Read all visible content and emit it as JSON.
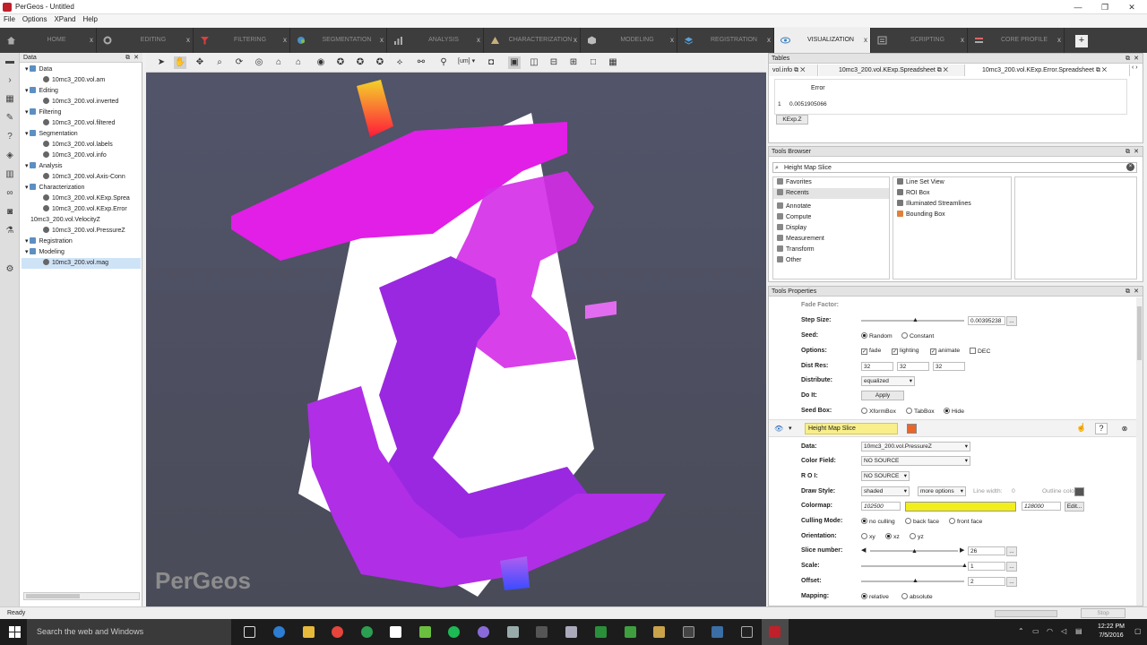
{
  "window": {
    "title": "PerGeos - Untitled"
  },
  "menu": [
    "File",
    "Options",
    "XPand",
    "Help"
  ],
  "tabs": [
    {
      "label": "HOME",
      "icon": "home-icon"
    },
    {
      "label": "EDITING",
      "icon": "gears-icon"
    },
    {
      "label": "FILTERING",
      "icon": "filter-icon"
    },
    {
      "label": "SEGMENTATION",
      "icon": "segmentation-icon"
    },
    {
      "label": "ANALYSIS",
      "icon": "chart-icon"
    },
    {
      "label": "CHARACTERIZATION",
      "icon": "characterization-icon"
    },
    {
      "label": "MODELING",
      "icon": "cube-icon"
    },
    {
      "label": "REGISTRATION",
      "icon": "layers-icon"
    },
    {
      "label": "VISUALIZATION",
      "icon": "eye-icon",
      "active": true
    },
    {
      "label": "SCRIPTING",
      "icon": "script-icon"
    },
    {
      "label": "CORE PROFILE",
      "icon": "core-profile-icon"
    }
  ],
  "data_panel": {
    "title": "Data",
    "tree": [
      {
        "label": "Data",
        "level": 0,
        "kind": "folder"
      },
      {
        "label": "10mc3_200.vol.am",
        "level": 1,
        "kind": "item"
      },
      {
        "label": "Editing",
        "level": 0,
        "kind": "folder"
      },
      {
        "label": "10mc3_200.vol.inverted",
        "level": 1,
        "kind": "item"
      },
      {
        "label": "Filtering",
        "level": 0,
        "kind": "folder"
      },
      {
        "label": "10mc3_200.vol.filtered",
        "level": 1,
        "kind": "item"
      },
      {
        "label": "Segmentation",
        "level": 0,
        "kind": "folder"
      },
      {
        "label": "10mc3_200.vol.labels",
        "level": 1,
        "kind": "item"
      },
      {
        "label": "10mc3_200.vol.info",
        "level": 1,
        "kind": "item"
      },
      {
        "label": "Analysis",
        "level": 0,
        "kind": "folder"
      },
      {
        "label": "10mc3_200.vol.Axis-Conn",
        "level": 1,
        "kind": "item"
      },
      {
        "label": "Characterization",
        "level": 0,
        "kind": "folder"
      },
      {
        "label": "10mc3_200.vol.KExp.Sprea",
        "level": 1,
        "kind": "item"
      },
      {
        "label": "10mc3_200.vol.KExp.Error",
        "level": 1,
        "kind": "item"
      },
      {
        "label": "10mc3_200.vol.VelocityZ",
        "level": 1,
        "kind": "plain"
      },
      {
        "label": "10mc3_200.vol.PressureZ",
        "level": 1,
        "kind": "item"
      },
      {
        "label": "Registration",
        "level": 0,
        "kind": "folder"
      },
      {
        "label": "Modeling",
        "level": 0,
        "kind": "folder"
      },
      {
        "label": "10mc3_200.vol.mag",
        "level": 1,
        "kind": "item",
        "selected": true
      }
    ]
  },
  "viewer": {
    "watermark": "PerGeos",
    "unit": "[um]"
  },
  "tables_panel": {
    "title": "Tables",
    "tabs": [
      "vol.info",
      "10mc3_200.vol.KExp.Spreadsheet",
      "10mc3_200.vol.KExp.Error.Spreadsheet"
    ],
    "column": "Error",
    "row_index": "1",
    "row_value": "0.0051905066",
    "bottom_tab": "KExp.Z"
  },
  "tools_browser": {
    "title": "Tools Browser",
    "search_value": "Height Map Slice",
    "categories": [
      "Favorites",
      "Recents",
      "Annotate",
      "Compute",
      "Display",
      "Measurement",
      "Transform",
      "Other"
    ],
    "selected_category": "Recents",
    "tools": [
      "Line Set View",
      "ROI Box",
      "Illuminated Streamlines",
      "Bounding Box"
    ]
  },
  "tools_properties": {
    "title": "Tools Properties",
    "partial_top_label": "Fade Factor:",
    "step_size": {
      "label": "Step Size:",
      "value": "0.00395238"
    },
    "seed": {
      "label": "Seed:",
      "options": [
        "Random",
        "Constant"
      ],
      "selected": "Random"
    },
    "options": {
      "label": "Options:",
      "items": [
        "fade",
        "lighting",
        "animate",
        "DEC"
      ],
      "checked": [
        "fade",
        "lighting",
        "animate"
      ]
    },
    "dist_res": {
      "label": "Dist Res:",
      "values": [
        "32",
        "32",
        "32"
      ]
    },
    "distribute": {
      "label": "Distribute:",
      "value": "equalized"
    },
    "do_it": {
      "label": "Do It:",
      "button": "Apply"
    },
    "seed_box": {
      "label": "Seed Box:",
      "options": [
        "XformBox",
        "TabBox",
        "Hide"
      ],
      "selected": "Hide"
    },
    "module": {
      "name": "Height Map Slice",
      "color": "#e9652a"
    },
    "data": {
      "label": "Data:",
      "value": "10mc3_200.vol.PressureZ"
    },
    "color_field": {
      "label": "Color Field:",
      "value": "NO SOURCE"
    },
    "roi": {
      "label": "R O I:",
      "value": "NO SOURCE"
    },
    "draw_style": {
      "label": "Draw Style:",
      "value": "shaded",
      "more": "more options",
      "line_width_label": "Line width:",
      "line_width": "0",
      "outline_label": "Outline color:"
    },
    "colormap": {
      "label": "Colormap:",
      "min": "102500",
      "max": "128000",
      "edit": "Edit...",
      "color": "#f2ee1c"
    },
    "culling": {
      "label": "Culling Mode:",
      "options": [
        "no culling",
        "back face",
        "front face"
      ],
      "selected": "no culling"
    },
    "orientation": {
      "label": "Orientation:",
      "options": [
        "xy",
        "xz",
        "yz"
      ],
      "selected": "xz"
    },
    "slice_number": {
      "label": "Slice number:",
      "value": "26"
    },
    "scale": {
      "label": "Scale:",
      "value": "1"
    },
    "offset": {
      "label": "Offset:",
      "value": "2"
    },
    "mapping": {
      "label": "Mapping:",
      "options": [
        "relative",
        "absolute"
      ],
      "selected": "relative"
    }
  },
  "status": {
    "text": "Ready",
    "stop": "Stop"
  },
  "taskbar": {
    "search": "Search the web and Windows",
    "time": "12:22 PM",
    "date": "7/5/2016"
  }
}
